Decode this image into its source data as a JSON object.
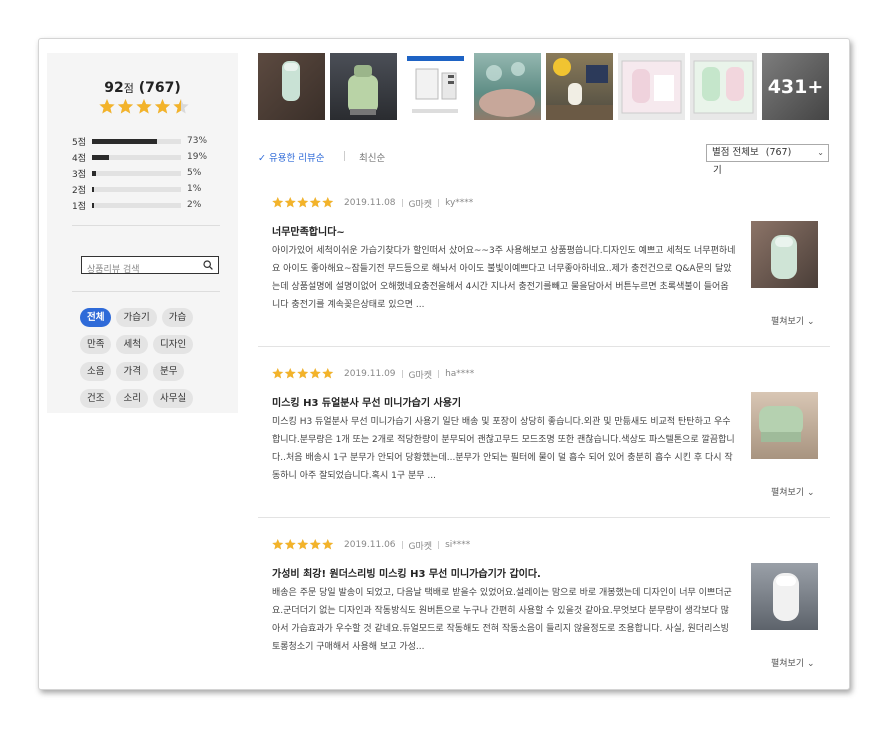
{
  "rating": {
    "score": "92",
    "unit": "점",
    "count": "767",
    "stars": 4.5,
    "distribution": [
      {
        "label": "5점",
        "fraction": 0.73,
        "percent": "73%"
      },
      {
        "label": "4점",
        "fraction": 0.19,
        "percent": "19%"
      },
      {
        "label": "3점",
        "fraction": 0.05,
        "percent": "5%"
      },
      {
        "label": "2점",
        "fraction": 0.01,
        "percent": "1%"
      },
      {
        "label": "1점",
        "fraction": 0.02,
        "percent": "2%"
      }
    ]
  },
  "search": {
    "placeholder": "상품리뷰 검색"
  },
  "tags": [
    "전체",
    "가습기",
    "가습",
    "만족",
    "세척",
    "디자인",
    "소음",
    "가격",
    "분무",
    "건조",
    "소리",
    "사무실"
  ],
  "photos": {
    "more_label": "431+"
  },
  "sort": {
    "helpful": "유용한 리뷰순",
    "latest": "최신순"
  },
  "filter": {
    "label": "별점 전체보",
    "count": "(767)",
    "wrap": "기"
  },
  "reviews": [
    {
      "date": "2019.11.08",
      "market": "G마켓",
      "user": "ky****",
      "title": "너무만족합니다~",
      "body": "아이가있어 세척이쉬운 가습기찾다가 할인떠서 샀어요~~3주 사용해보고 상품평씁니다.디자인도 예쁘고 세척도 너무편하네요 아이도 좋아해요~잠들기전 무드등으로 해놔서 아이도 불빛이예쁘다고 너무좋아하네요..제가 충전건으로 Q&A문의 달았는데 상품설명에 설명이없어 오해했네요충전을해서 4시간 지나서 충전기를빼고 물을담아서 버튼누르면 초록색불이 들어옵니다 충전기를 계속꽂은상태로 있으면 ...",
      "more": "펼쳐보기"
    },
    {
      "date": "2019.11.09",
      "market": "G마켓",
      "user": "ha****",
      "title": "미스킹 H3 듀얼분사 무선 미니가습기 사용기",
      "body": "미스킹 H3 듀얼분사 무선 미니가습기 사용기 일단 배송 및 포장이 상당히 좋습니다.외관 및 만듦새도 비교적 탄탄하고 우수합니다.분무량은 1개 또는 2개로 적당한량이 분무되어 괜찮고무드 모드조명 또한 괜찮습니다.색상도 파스텔톤으로 깔끔합니다..처음 배송시 1구 분무가 안되어 당황했는데...분무가 안되는 필터에 물이 덜 흡수 되어 있어 충분히 흡수 시킨 후 다시 작동하니 아주 잘되었습니다.혹시 1구 분무 ...",
      "more": "펼쳐보기"
    },
    {
      "date": "2019.11.06",
      "market": "G마켓",
      "user": "si****",
      "title": "가성비 최강! 원더스리빙 미스킹 H3 무선 미니가습기가 갑이다.",
      "body": "배송은 주문 당일 발송이 되었고, 다음날 택배로 받을수 있었어요.설레이는 맘으로 바로 개봉했는데 디자인이 너무 이쁘더군요.군더더기 없는 디자인과 작동방식도 원버튼으로 누구나 간편히 사용할 수 있을것 같아요.무엇보다 분무량이 생각보다 많아서 가습효과가 우수할 것 같네요.듀얼모드로 작동해도 전혀 작동소음이 들리지 않을정도로 조용합니다. 사실, 원더리스빙 토롱청소기 구매해서 사용해 보고 가성...",
      "more": "펼쳐보기"
    }
  ],
  "colors": {
    "accent": "#2e6ad8",
    "star": "#f3b32a"
  }
}
